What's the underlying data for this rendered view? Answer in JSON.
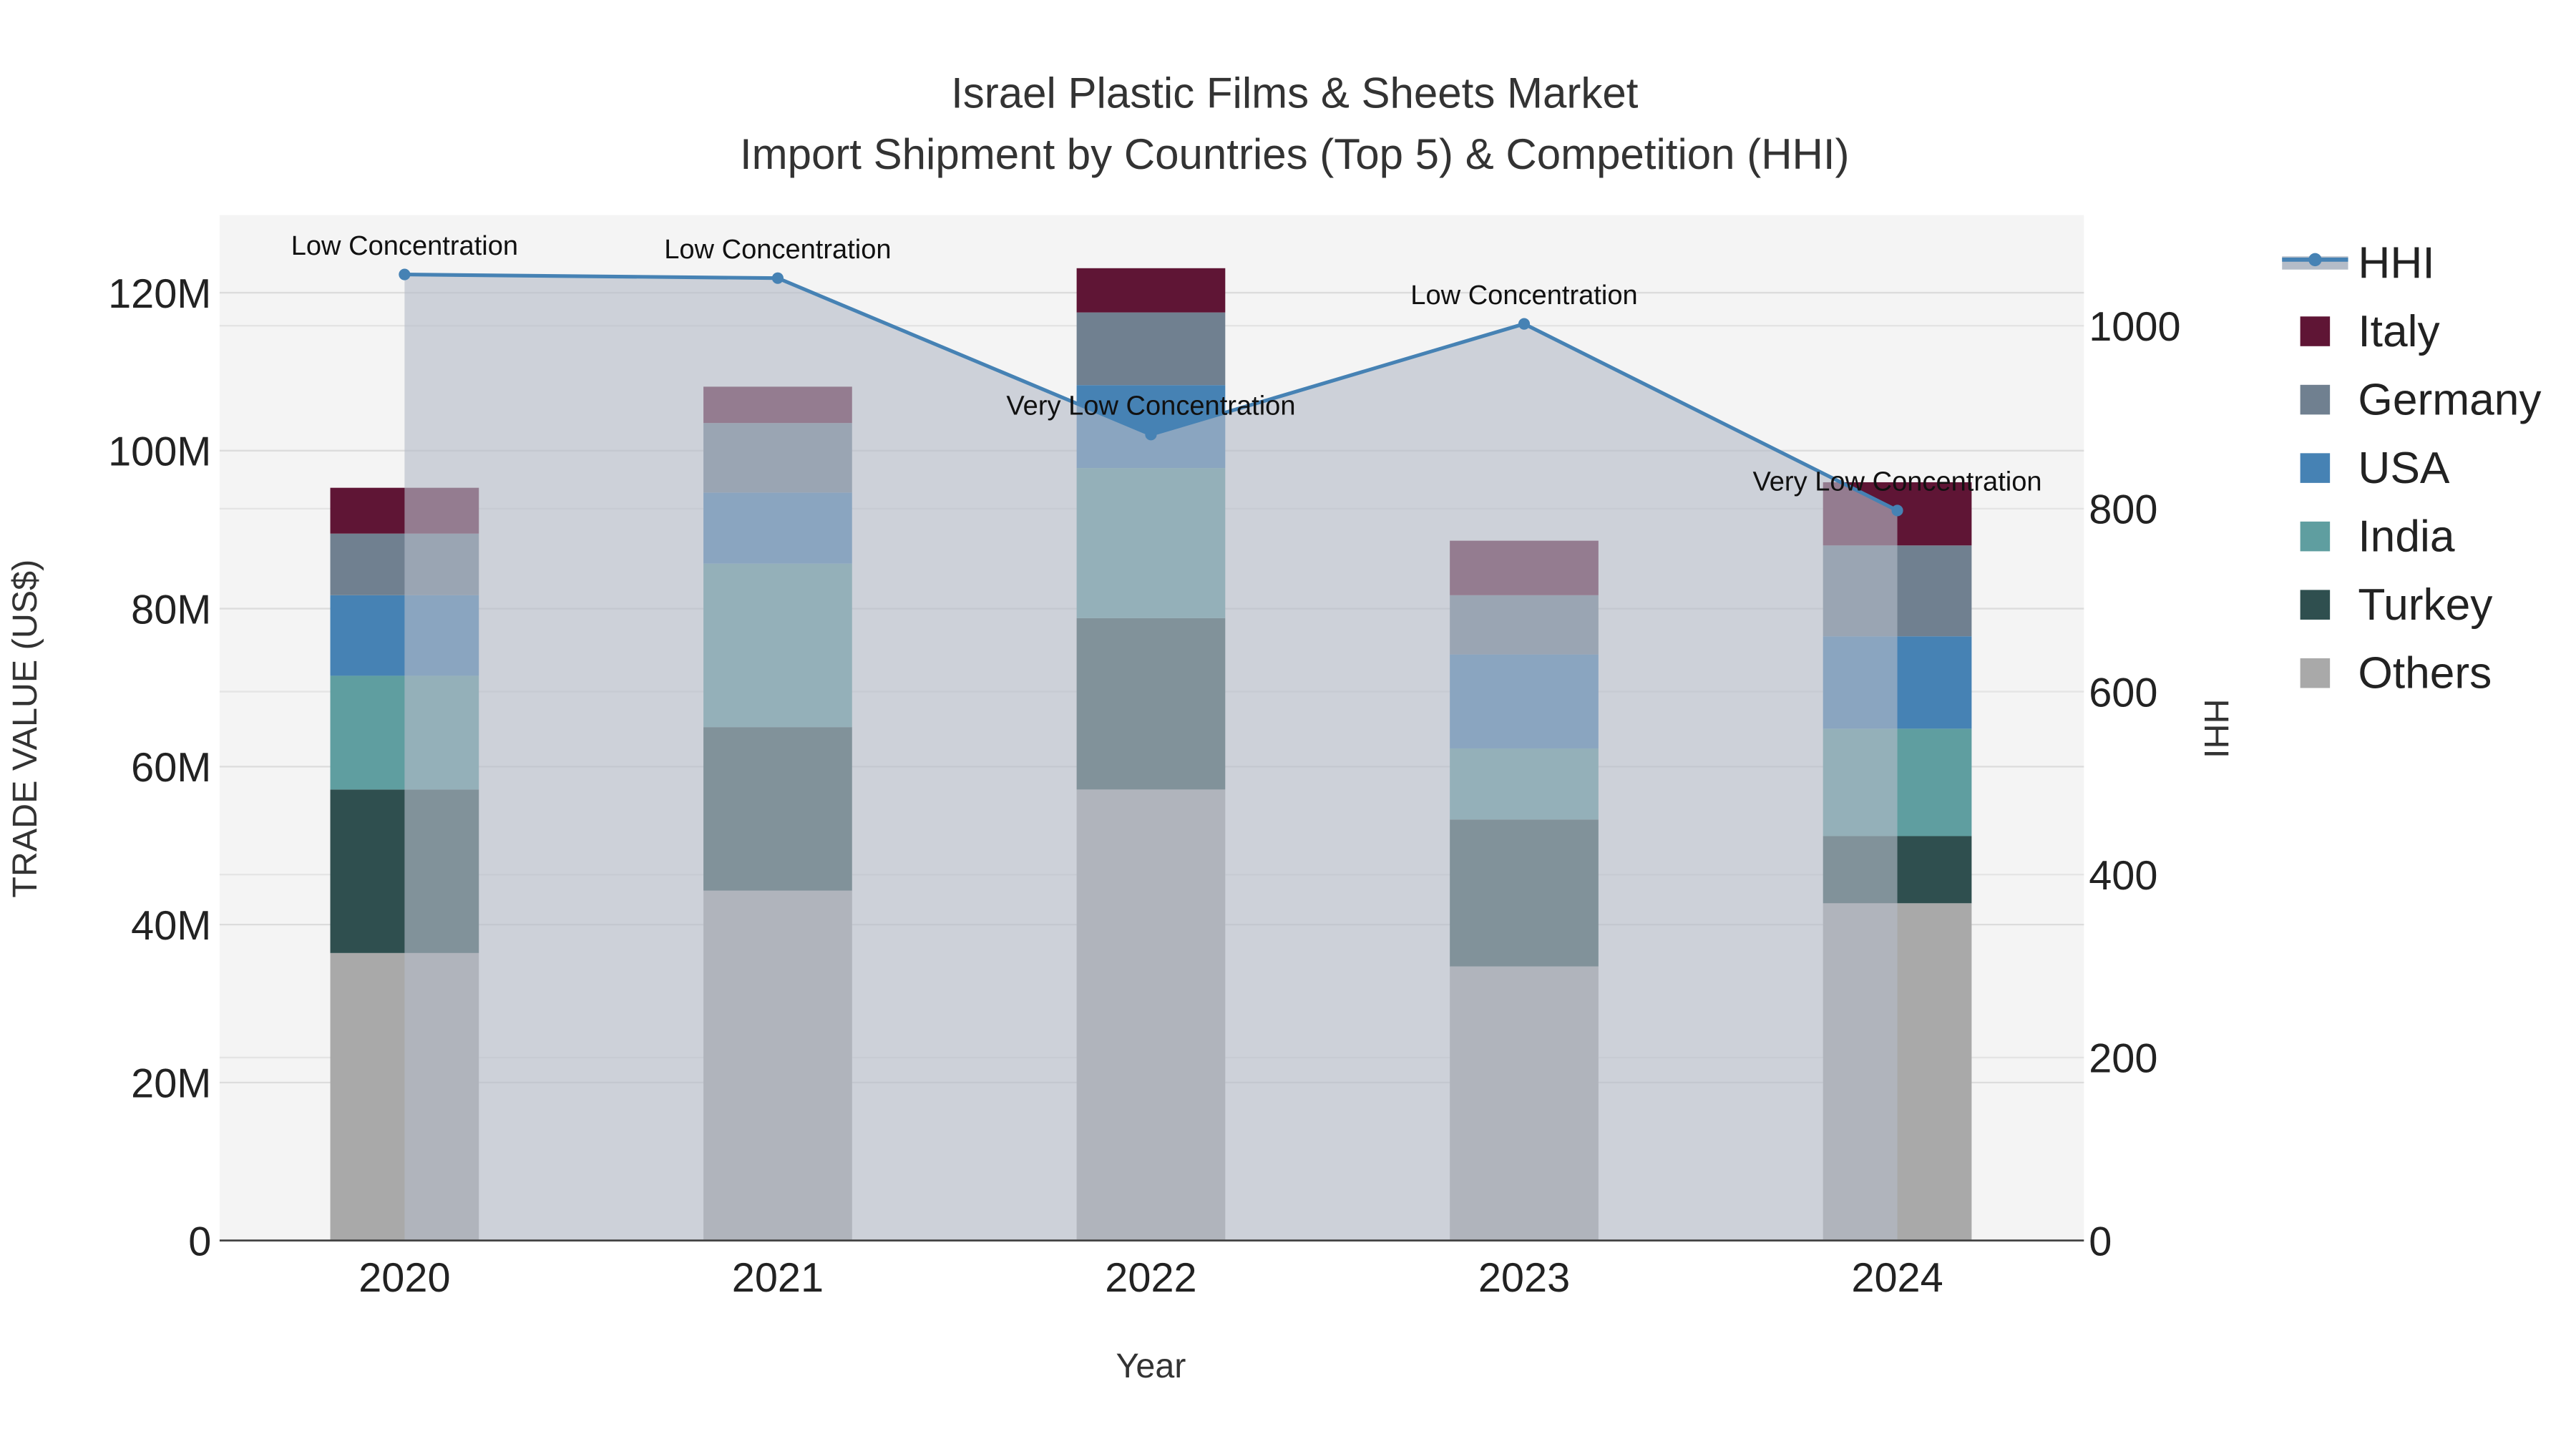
{
  "chart_data": {
    "type": "bar",
    "title_line1": "Israel Plastic Films & Sheets Market",
    "title_line2": "Import Shipment by Countries (Top 5) & Competition (HHI)",
    "xlabel": "Year",
    "ylabel": "TRADE VALUE (US$)",
    "y2label": "HHI",
    "categories": [
      "2020",
      "2021",
      "2022",
      "2023",
      "2024"
    ],
    "ylim": [
      0,
      130000000
    ],
    "y2lim": [
      0,
      1120
    ],
    "yticks": [
      {
        "v": 0,
        "label": "0"
      },
      {
        "v": 20000000,
        "label": "20M"
      },
      {
        "v": 40000000,
        "label": "40M"
      },
      {
        "v": 60000000,
        "label": "60M"
      },
      {
        "v": 80000000,
        "label": "80M"
      },
      {
        "v": 100000000,
        "label": "100M"
      },
      {
        "v": 120000000,
        "label": "120M"
      }
    ],
    "y2ticks": [
      {
        "v": 0,
        "label": "0"
      },
      {
        "v": 200,
        "label": "200"
      },
      {
        "v": 400,
        "label": "400"
      },
      {
        "v": 600,
        "label": "600"
      },
      {
        "v": 800,
        "label": "800"
      },
      {
        "v": 1000,
        "label": "1000"
      }
    ],
    "series": [
      {
        "name": "Others",
        "color": "#a9a9a9",
        "values": [
          36.4,
          44.3,
          57.1,
          34.7,
          42.7
        ]
      },
      {
        "name": "Turkey",
        "color": "#2f4f4f",
        "values": [
          20.7,
          20.7,
          21.7,
          18.6,
          8.5
        ]
      },
      {
        "name": "India",
        "color": "#5f9ea0",
        "values": [
          14.4,
          20.7,
          19.0,
          9.0,
          13.6
        ]
      },
      {
        "name": "USA",
        "color": "#4682b4",
        "values": [
          10.2,
          9.0,
          10.5,
          11.9,
          11.7
        ]
      },
      {
        "name": "Germany",
        "color": "#708090",
        "values": [
          7.8,
          8.8,
          9.2,
          7.5,
          11.5
        ]
      },
      {
        "name": "Italy",
        "color": "#5f1535",
        "values": [
          5.8,
          4.6,
          5.6,
          6.9,
          8.0
        ]
      }
    ],
    "value_unit": "millions US$",
    "hhi": {
      "name": "HHI",
      "color": "#4682b4",
      "values": [
        1056,
        1052,
        881,
        1002,
        798
      ],
      "annotations": [
        "Low Concentration",
        "Low Concentration",
        "Very Low Concentration",
        "Low Concentration",
        "Very Low Concentration"
      ]
    },
    "legend": [
      "HHI",
      "Italy",
      "Germany",
      "USA",
      "India",
      "Turkey",
      "Others"
    ],
    "legend_placement": "right",
    "grid": true
  }
}
